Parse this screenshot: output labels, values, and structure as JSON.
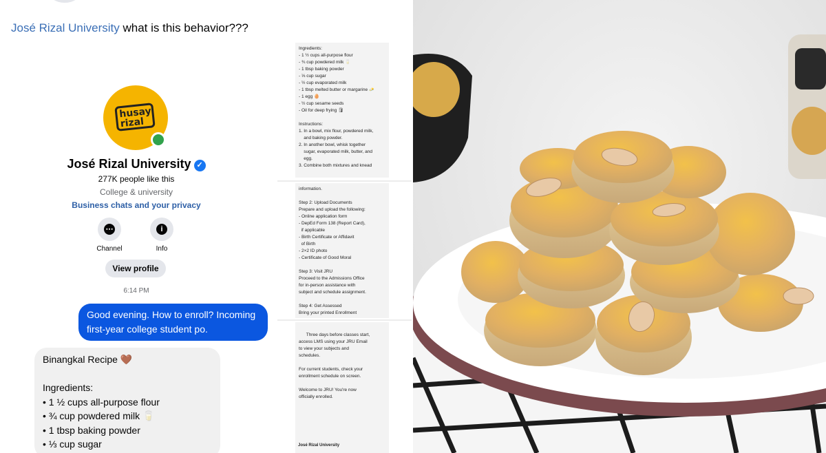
{
  "post": {
    "mention": "José Rizal University",
    "caption": " what is this behavior???"
  },
  "chat": {
    "logo_text": "husay rizal",
    "page_name": "José Rizal University",
    "likes": "277K people like this",
    "category": "College & university",
    "privacy_link": "Business chats and your privacy",
    "buttons": [
      {
        "label": "Channel",
        "icon": "channel-icon"
      },
      {
        "label": "Info",
        "icon": "info-icon"
      }
    ],
    "view_profile": "View profile",
    "timestamp": "6:14 PM",
    "outgoing_message": "Good evening. How to enroll? Incoming first-year college student po.",
    "incoming_message": "Binangkal Recipe 🤎\n\nIngredients:\n• 1 ½ cups all-purpose flour\n• ¾ cup powdered milk 🥛\n• 1 tbsp baking powder\n• ⅓ cup sugar"
  },
  "strip": {
    "card1": "Ingredients:\n- 1 ½ cups all-purpose flour\n- ¾ cup powdered milk 🥛\n- 1 tbsp baking powder\n- ⅓ cup sugar\n- ½ cup evaporated milk\n- 1 tbsp melted butter or margarine 🧈\n- 1 egg 🥚\n- ½ cup sesame seeds\n- Oil for deep frying 🛢\n\nInstructions:\n1. In a bowl, mix flour, powdered milk,\n    and baking powder.\n2. In another bowl, whisk together\n    sugar, evaporated milk, butter, and\n    egg.\n3. Combine both mixtures and knead",
    "card2": "information.\n\nStep 2: Upload Documents\nPrepare and upload the following:\n- Online application form\n- DepEd Form 138 (Report Card),\n  if applicable\n- Birth Certificate or Affidavit\n  of Birth\n- 2×2 ID photo\n- Certificate of Good Moral\n\nStep 3: Visit JRU\nProceed to the Admissions Office\nfor in-person assistance with\nsubject and schedule assignment.\n\nStep 4: Get Assessed\nBring your printed Enrollment",
    "card3": "Three days before classes start,\naccess LMS using your JRU Email\nto view your subjects and\nschedules.\n\nFor current students, check your\nenrollment schedule on screen.\n\nWelcome to JRU! You're now\nofficially enrolled.",
    "card3_sender": "José Rizal University"
  },
  "colors": {
    "link_blue": "#3b6fb6",
    "outgoing_bubble": "#0b57e0",
    "incoming_bubble": "#f0f0f0",
    "logo_yellow": "#f5b400",
    "online_green": "#31a24c"
  }
}
